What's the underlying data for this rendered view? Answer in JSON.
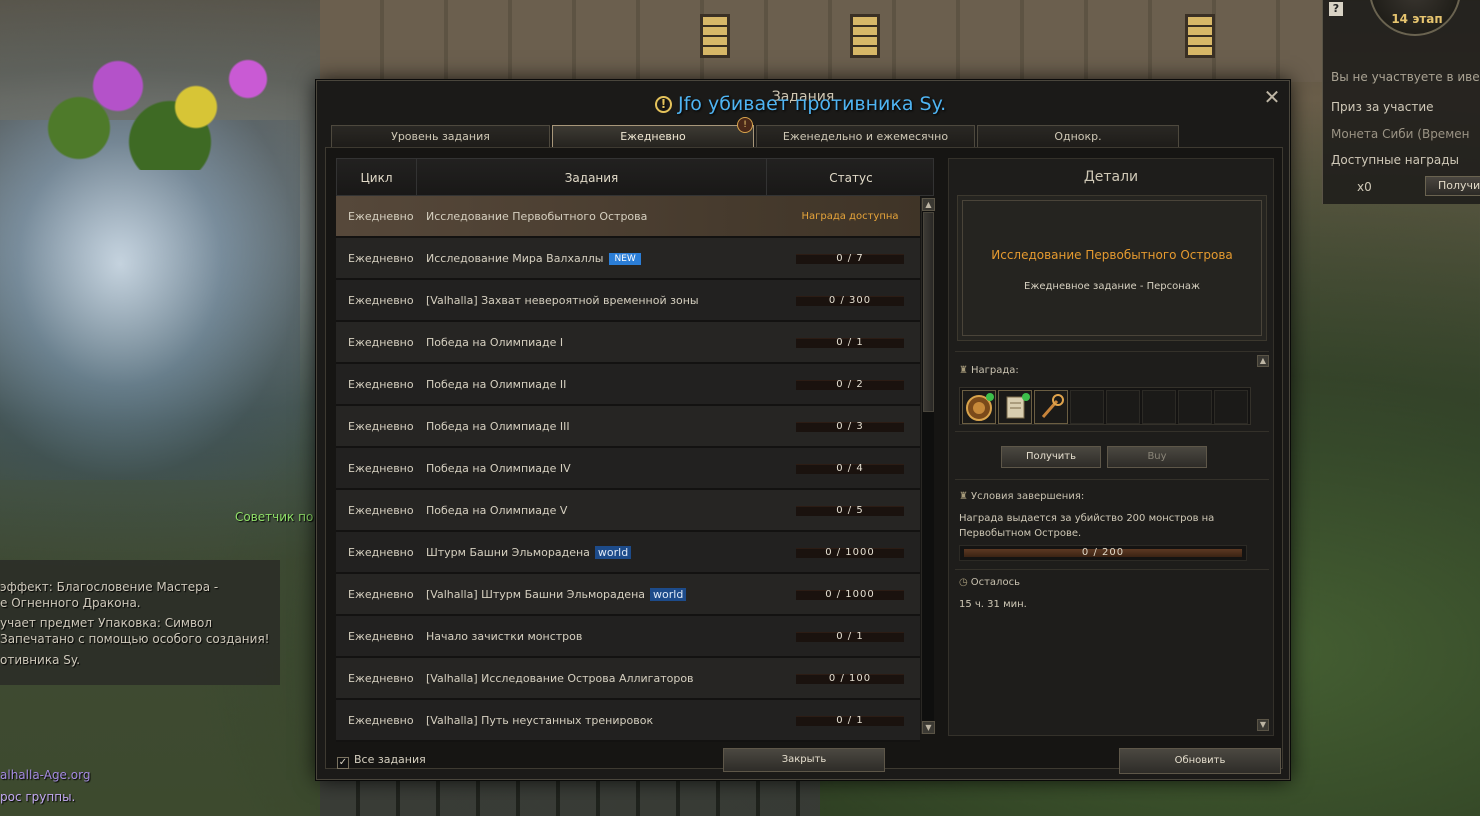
{
  "background": {
    "advisor_label": "Советчик по ...",
    "chat_lines": [
      "эффект: Благословение Мастера -",
      "е Огненного Дракона.",
      "учает предмет Упаковка: Символ",
      "Запечатано с помощью особого создания!",
      "отивника Sy."
    ],
    "site_link": "alhalla-Age.org",
    "group_request": "рос группы."
  },
  "event_panel": {
    "help": "?",
    "stage": "14 этап",
    "not_participating": "Вы не участвуете в ивенте",
    "participation_prize": "Приз за участие",
    "coin_item": "Монета Сиби (Времен",
    "available_rewards": "Доступные награды",
    "reward_count": "x0",
    "receive_button": "Получи"
  },
  "dialog": {
    "title": "Задания",
    "close": "✕",
    "system_notice": "Jfo убивает противника Sy.",
    "notice_icon": "!",
    "tabs": [
      {
        "label": "Уровень задания",
        "active": false
      },
      {
        "label": "Ежедневно",
        "active": true
      },
      {
        "label": "Еженедельно и ежемесячно",
        "active": false
      },
      {
        "label": "Однокр.",
        "active": false
      }
    ],
    "tab_badge": "!",
    "table": {
      "headers": {
        "cycle": "Цикл",
        "quest": "Задания",
        "status": "Статус"
      },
      "rows": [
        {
          "cycle": "Ежедневно",
          "name": "Исследование Первобытного Острова",
          "tag": "",
          "status_text": "Награда доступна",
          "progress": 1,
          "ready": true,
          "selected": true
        },
        {
          "cycle": "Ежедневно",
          "name": "Исследование Мира Валхаллы",
          "tag": "NEW",
          "status_text": "0 / 7",
          "progress": 0,
          "ready": false,
          "selected": false
        },
        {
          "cycle": "Ежедневно",
          "name": "[Valhalla] Захват невероятной временной зоны",
          "tag": "",
          "status_text": "0 / 300",
          "progress": 0,
          "ready": false,
          "selected": false
        },
        {
          "cycle": "Ежедневно",
          "name": "Победа на Олимпиаде I",
          "tag": "",
          "status_text": "0 / 1",
          "progress": 0,
          "ready": false,
          "selected": false
        },
        {
          "cycle": "Ежедневно",
          "name": "Победа на Олимпиаде II",
          "tag": "",
          "status_text": "0 / 2",
          "progress": 0,
          "ready": false,
          "selected": false
        },
        {
          "cycle": "Ежедневно",
          "name": "Победа на Олимпиаде III",
          "tag": "",
          "status_text": "0 / 3",
          "progress": 0,
          "ready": false,
          "selected": false
        },
        {
          "cycle": "Ежедневно",
          "name": "Победа на Олимпиаде IV",
          "tag": "",
          "status_text": "0 / 4",
          "progress": 0,
          "ready": false,
          "selected": false
        },
        {
          "cycle": "Ежедневно",
          "name": "Победа на Олимпиаде V",
          "tag": "",
          "status_text": "0 / 5",
          "progress": 0,
          "ready": false,
          "selected": false
        },
        {
          "cycle": "Ежедневно",
          "name": "Штурм Башни Эльморадена",
          "tag": "world",
          "status_text": "0 / 1000",
          "progress": 0,
          "ready": false,
          "selected": false
        },
        {
          "cycle": "Ежедневно",
          "name": "[Valhalla] Штурм Башни Эльморадена",
          "tag": "world",
          "status_text": "0 / 1000",
          "progress": 0,
          "ready": false,
          "selected": false
        },
        {
          "cycle": "Ежедневно",
          "name": "Начало зачистки монстров",
          "tag": "",
          "status_text": "0 / 1",
          "progress": 0,
          "ready": false,
          "selected": false
        },
        {
          "cycle": "Ежедневно",
          "name": "[Valhalla] Исследование Острова Аллигаторов",
          "tag": "",
          "status_text": "0 / 100",
          "progress": 0,
          "ready": false,
          "selected": false
        },
        {
          "cycle": "Ежедневно",
          "name": "[Valhalla] Путь неустанных тренировок",
          "tag": "",
          "status_text": "0 / 1",
          "progress": 0,
          "ready": false,
          "selected": false
        }
      ]
    },
    "details": {
      "title": "Детали",
      "quest_name": "Исследование Первобытного Острова",
      "quest_sub": "Ежедневное задание  -  Персонаж",
      "reward_label": "Награда:",
      "reward_items": [
        "tome-icon",
        "scroll-icon",
        "key-icon"
      ],
      "reward_slot_count": 8,
      "receive_button": "Получить",
      "buy_button": "Buy",
      "conditions_label": "Условия завершения:",
      "conditions_text": "Награда выдается за убийство 200 монстров на Первобытном Острове.",
      "condition_progress": "0 / 200",
      "remaining_label": "Осталось",
      "remaining_value": "15 ч. 31 мин."
    },
    "footer": {
      "all_quests_label": "Все задания",
      "all_quests_checked": true,
      "close_button": "Закрыть",
      "refresh_button": "Обновить"
    }
  },
  "colors": {
    "accent_orange": "#e59a2f",
    "notice_blue": "#4fb4f2",
    "new_tag": "#2b7ed7",
    "world_tag": "#1d4b8a",
    "advisor_green": "#8fdf68"
  }
}
